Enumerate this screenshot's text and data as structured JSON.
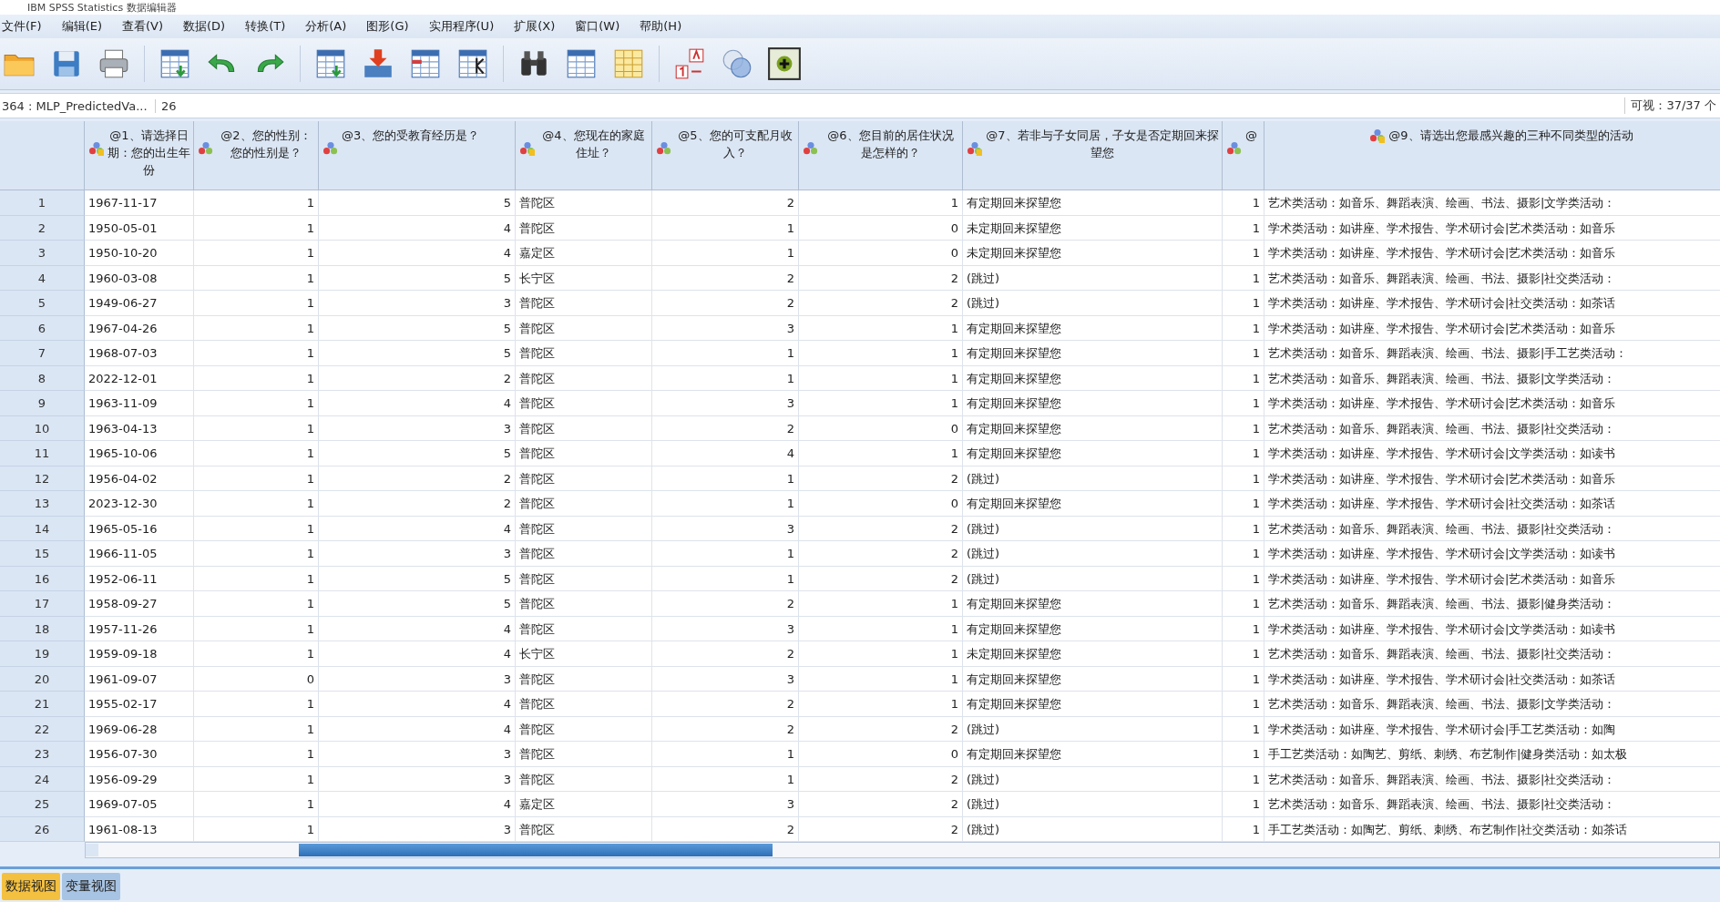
{
  "window": {
    "title": "IBM SPSS Statistics 数据编辑器"
  },
  "menu": [
    "文件(F)",
    "编辑(E)",
    "查看(V)",
    "数据(D)",
    "转换(T)",
    "分析(A)",
    "图形(G)",
    "实用程序(U)",
    "扩展(X)",
    "窗口(W)",
    "帮助(H)"
  ],
  "cell_bar": {
    "cell_ref": "364 : MLP_PredictedVa...",
    "value": "26",
    "visible_count": "可视：37/37 个"
  },
  "table": {
    "columns": [
      {
        "header": "@1、请选择日期：您的出生年份",
        "kind": "string"
      },
      {
        "header": "@2、您的性别：您的性别是？",
        "kind": "nominal"
      },
      {
        "header": "@3、您的受教育经历是？",
        "kind": "nominal"
      },
      {
        "header": "@4、您现在的家庭住址？",
        "kind": "string"
      },
      {
        "header": "@5、您的可支配月收入？",
        "kind": "nominal"
      },
      {
        "header": "@6、您目前的居住状况是怎样的？",
        "kind": "nominal"
      },
      {
        "header": "@7、若非与子女同居，子女是否定期回来探望您",
        "kind": "string"
      },
      {
        "header": "@",
        "kind": "nominal"
      },
      {
        "header": "@9、请选出您最感兴趣的三种不同类型的活动",
        "kind": "string"
      }
    ],
    "rows": [
      {
        "n": "1",
        "cells": [
          "1967-11-17",
          "1",
          "5",
          "普陀区",
          "2",
          "1",
          "有定期回来探望您",
          "1",
          "艺术类活动：如音乐、舞蹈表演、绘画、书法、摄影|文学类活动："
        ]
      },
      {
        "n": "2",
        "cells": [
          "1950-05-01",
          "1",
          "4",
          "普陀区",
          "1",
          "0",
          "未定期回来探望您",
          "1",
          "学术类活动：如讲座、学术报告、学术研讨会|艺术类活动：如音乐"
        ]
      },
      {
        "n": "3",
        "cells": [
          "1950-10-20",
          "1",
          "4",
          "嘉定区",
          "1",
          "0",
          "未定期回来探望您",
          "1",
          "学术类活动：如讲座、学术报告、学术研讨会|艺术类活动：如音乐"
        ]
      },
      {
        "n": "4",
        "cells": [
          "1960-03-08",
          "1",
          "5",
          "长宁区",
          "2",
          "2",
          "(跳过)",
          "1",
          "艺术类活动：如音乐、舞蹈表演、绘画、书法、摄影|社交类活动："
        ]
      },
      {
        "n": "5",
        "cells": [
          "1949-06-27",
          "1",
          "3",
          "普陀区",
          "2",
          "2",
          "(跳过)",
          "1",
          "学术类活动：如讲座、学术报告、学术研讨会|社交类活动：如茶话"
        ]
      },
      {
        "n": "6",
        "cells": [
          "1967-04-26",
          "1",
          "5",
          "普陀区",
          "3",
          "1",
          "有定期回来探望您",
          "1",
          "学术类活动：如讲座、学术报告、学术研讨会|艺术类活动：如音乐"
        ]
      },
      {
        "n": "7",
        "cells": [
          "1968-07-03",
          "1",
          "5",
          "普陀区",
          "1",
          "1",
          "有定期回来探望您",
          "1",
          "艺术类活动：如音乐、舞蹈表演、绘画、书法、摄影|手工艺类活动："
        ]
      },
      {
        "n": "8",
        "cells": [
          "2022-12-01",
          "1",
          "2",
          "普陀区",
          "1",
          "1",
          "有定期回来探望您",
          "1",
          "艺术类活动：如音乐、舞蹈表演、绘画、书法、摄影|文学类活动："
        ]
      },
      {
        "n": "9",
        "cells": [
          "1963-11-09",
          "1",
          "4",
          "普陀区",
          "3",
          "1",
          "有定期回来探望您",
          "1",
          "学术类活动：如讲座、学术报告、学术研讨会|艺术类活动：如音乐"
        ]
      },
      {
        "n": "10",
        "cells": [
          "1963-04-13",
          "1",
          "3",
          "普陀区",
          "2",
          "0",
          "有定期回来探望您",
          "1",
          "艺术类活动：如音乐、舞蹈表演、绘画、书法、摄影|社交类活动："
        ]
      },
      {
        "n": "11",
        "cells": [
          "1965-10-06",
          "1",
          "5",
          "普陀区",
          "4",
          "1",
          "有定期回来探望您",
          "1",
          "学术类活动：如讲座、学术报告、学术研讨会|文学类活动：如读书"
        ]
      },
      {
        "n": "12",
        "cells": [
          "1956-04-02",
          "1",
          "2",
          "普陀区",
          "1",
          "2",
          "(跳过)",
          "1",
          "学术类活动：如讲座、学术报告、学术研讨会|艺术类活动：如音乐"
        ]
      },
      {
        "n": "13",
        "cells": [
          "2023-12-30",
          "1",
          "2",
          "普陀区",
          "1",
          "0",
          "有定期回来探望您",
          "1",
          "学术类活动：如讲座、学术报告、学术研讨会|社交类活动：如茶话"
        ]
      },
      {
        "n": "14",
        "cells": [
          "1965-05-16",
          "1",
          "4",
          "普陀区",
          "3",
          "2",
          "(跳过)",
          "1",
          "艺术类活动：如音乐、舞蹈表演、绘画、书法、摄影|社交类活动："
        ]
      },
      {
        "n": "15",
        "cells": [
          "1966-11-05",
          "1",
          "3",
          "普陀区",
          "1",
          "2",
          "(跳过)",
          "1",
          "学术类活动：如讲座、学术报告、学术研讨会|文学类活动：如读书"
        ]
      },
      {
        "n": "16",
        "cells": [
          "1952-06-11",
          "1",
          "5",
          "普陀区",
          "1",
          "2",
          "(跳过)",
          "1",
          "学术类活动：如讲座、学术报告、学术研讨会|艺术类活动：如音乐"
        ]
      },
      {
        "n": "17",
        "cells": [
          "1958-09-27",
          "1",
          "5",
          "普陀区",
          "2",
          "1",
          "有定期回来探望您",
          "1",
          "艺术类活动：如音乐、舞蹈表演、绘画、书法、摄影|健身类活动："
        ]
      },
      {
        "n": "18",
        "cells": [
          "1957-11-26",
          "1",
          "4",
          "普陀区",
          "3",
          "1",
          "有定期回来探望您",
          "1",
          "学术类活动：如讲座、学术报告、学术研讨会|文学类活动：如读书"
        ]
      },
      {
        "n": "19",
        "cells": [
          "1959-09-18",
          "1",
          "4",
          "长宁区",
          "2",
          "1",
          "未定期回来探望您",
          "1",
          "艺术类活动：如音乐、舞蹈表演、绘画、书法、摄影|社交类活动："
        ]
      },
      {
        "n": "20",
        "cells": [
          "1961-09-07",
          "0",
          "3",
          "普陀区",
          "3",
          "1",
          "有定期回来探望您",
          "1",
          "学术类活动：如讲座、学术报告、学术研讨会|社交类活动：如茶话"
        ]
      },
      {
        "n": "21",
        "cells": [
          "1955-02-17",
          "1",
          "4",
          "普陀区",
          "2",
          "1",
          "有定期回来探望您",
          "1",
          "艺术类活动：如音乐、舞蹈表演、绘画、书法、摄影|文学类活动："
        ]
      },
      {
        "n": "22",
        "cells": [
          "1969-06-28",
          "1",
          "4",
          "普陀区",
          "2",
          "2",
          "(跳过)",
          "1",
          "学术类活动：如讲座、学术报告、学术研讨会|手工艺类活动：如陶"
        ]
      },
      {
        "n": "23",
        "cells": [
          "1956-07-30",
          "1",
          "3",
          "普陀区",
          "1",
          "0",
          "有定期回来探望您",
          "1",
          "手工艺类活动：如陶艺、剪纸、刺绣、布艺制作|健身类活动：如太极"
        ]
      },
      {
        "n": "24",
        "cells": [
          "1956-09-29",
          "1",
          "3",
          "普陀区",
          "1",
          "2",
          "(跳过)",
          "1",
          "艺术类活动：如音乐、舞蹈表演、绘画、书法、摄影|社交类活动："
        ]
      },
      {
        "n": "25",
        "cells": [
          "1969-07-05",
          "1",
          "4",
          "嘉定区",
          "3",
          "2",
          "(跳过)",
          "1",
          "艺术类活动：如音乐、舞蹈表演、绘画、书法、摄影|社交类活动："
        ]
      },
      {
        "n": "26",
        "cells": [
          "1961-08-13",
          "1",
          "3",
          "普陀区",
          "2",
          "2",
          "(跳过)",
          "1",
          "手工艺类活动：如陶艺、剪纸、刺绣、布艺制作|社交类活动：如茶话"
        ]
      }
    ]
  },
  "view_tabs": [
    {
      "label": "数据视图",
      "selected": true
    },
    {
      "label": "变量视图",
      "selected": false
    }
  ]
}
